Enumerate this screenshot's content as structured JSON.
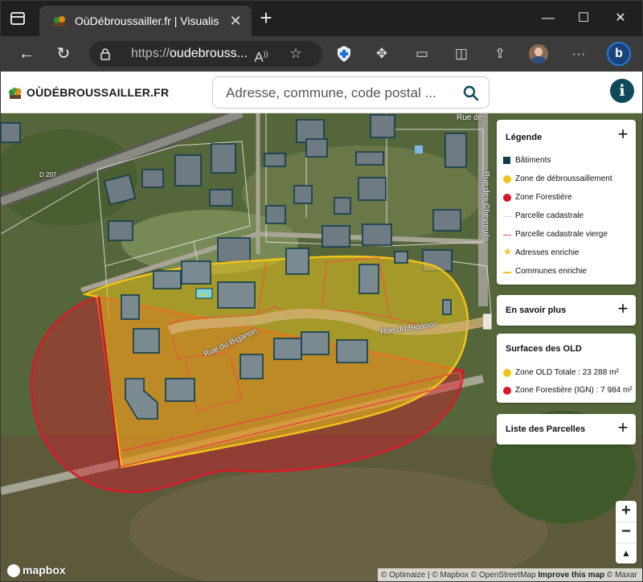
{
  "browser": {
    "tab_title": "OùDébroussailler.fr | Visualiser le",
    "url_prefix": "https://",
    "url_domain": "oudebrouss..."
  },
  "app": {
    "logo_text": "OÙDÉBROUSSAILLER.FR",
    "search_placeholder": "Adresse, commune, code postal ...",
    "info_label": "i"
  },
  "legend": {
    "title": "Légende",
    "items": [
      {
        "label": "Bâtiments",
        "color": "#0f3d4f",
        "symbol": "square"
      },
      {
        "label": "Zone de débroussaillement",
        "color": "#f2c318",
        "symbol": "circle"
      },
      {
        "label": "Zone Forestière",
        "color": "#d7192a",
        "symbol": "circle"
      },
      {
        "label": "Parcelle cadastrale",
        "color": "#e0e0e0",
        "symbol": "line"
      },
      {
        "label": "Parcelle cadastrale vierge",
        "color": "#e84a3c",
        "symbol": "line"
      },
      {
        "label": "Adresses enrichie",
        "color": "#f6c518",
        "symbol": "star"
      },
      {
        "label": "Communes enrichie",
        "color": "#f2c318",
        "symbol": "line"
      }
    ]
  },
  "panels": {
    "more_info": "En savoir plus",
    "surfaces_title": "Surfaces des OLD",
    "surface_items": [
      {
        "label": "Zone OLD Totale : 23 288 m²",
        "color": "#f2c318"
      },
      {
        "label": "Zone Forestière (IGN) : 7 984 m²",
        "color": "#d7192a"
      }
    ],
    "parcels": "Liste des Parcelles",
    "expand_symbol": "+"
  },
  "map": {
    "road_labels": [
      "Rue du Biganon",
      "Rue du Biganon",
      "Rue des Chevreuils",
      "D 207",
      "Rue de"
    ],
    "zoom_in": "+",
    "zoom_out": "−",
    "compass": "▲",
    "attribution_prefix": "© Optimaize | © Mapbox © OpenStreetMap ",
    "attribution_bold": "Improve this map",
    "attribution_suffix": " © Maxar",
    "mapbox_label": "mapbox"
  }
}
